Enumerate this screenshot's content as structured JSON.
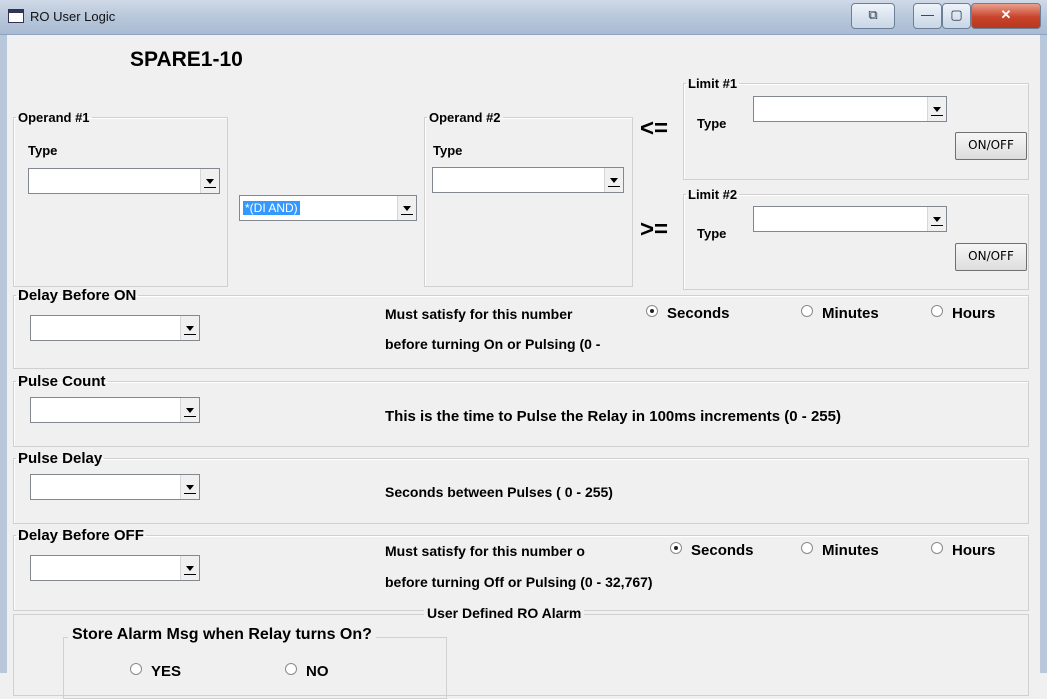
{
  "window": {
    "title": "RO User Logic",
    "restore_label": "⧉",
    "minimize_label": "—",
    "maximize_label": "▢",
    "close_label": "✕"
  },
  "heading": "SPARE1-10",
  "operand1": {
    "legend": "Operand #1",
    "type_label": "Type",
    "type_value": ""
  },
  "operator": {
    "value": "*(DI AND)"
  },
  "operand2": {
    "legend": "Operand #2",
    "type_label": "Type",
    "type_value": ""
  },
  "compare": {
    "le": "<=",
    "ge": ">="
  },
  "limit1": {
    "legend": "Limit #1",
    "type_label": "Type",
    "type_value": "",
    "onoff_label": "ON/OFF"
  },
  "limit2": {
    "legend": "Limit #2",
    "type_label": "Type",
    "type_value": "",
    "onoff_label": "ON/OFF"
  },
  "delay_on": {
    "legend": "Delay Before ON",
    "value": "",
    "desc_line1": "Must satisfy for this number",
    "desc_line2": "before turning On or Pulsing (0 -",
    "units": [
      "Seconds",
      "Minutes",
      "Hours"
    ],
    "selected": "Seconds"
  },
  "pulse_count": {
    "legend": "Pulse Count",
    "value": "",
    "desc": "This is the time to Pulse the Relay in 100ms increments (0 - 255)"
  },
  "pulse_delay": {
    "legend": "Pulse Delay",
    "value": "",
    "desc": "Seconds between Pulses ( 0 - 255)"
  },
  "delay_off": {
    "legend": "Delay Before OFF",
    "value": "",
    "desc_line1": "Must satisfy for this number o",
    "desc_line2": "before turning Off or Pulsing (0 - 32,767)",
    "units": [
      "Seconds",
      "Minutes",
      "Hours"
    ],
    "selected": "Seconds"
  },
  "alarm": {
    "legend": "User Defined RO Alarm",
    "store_legend": "Store Alarm Msg when Relay turns On?",
    "options": [
      "YES",
      "NO"
    ]
  }
}
